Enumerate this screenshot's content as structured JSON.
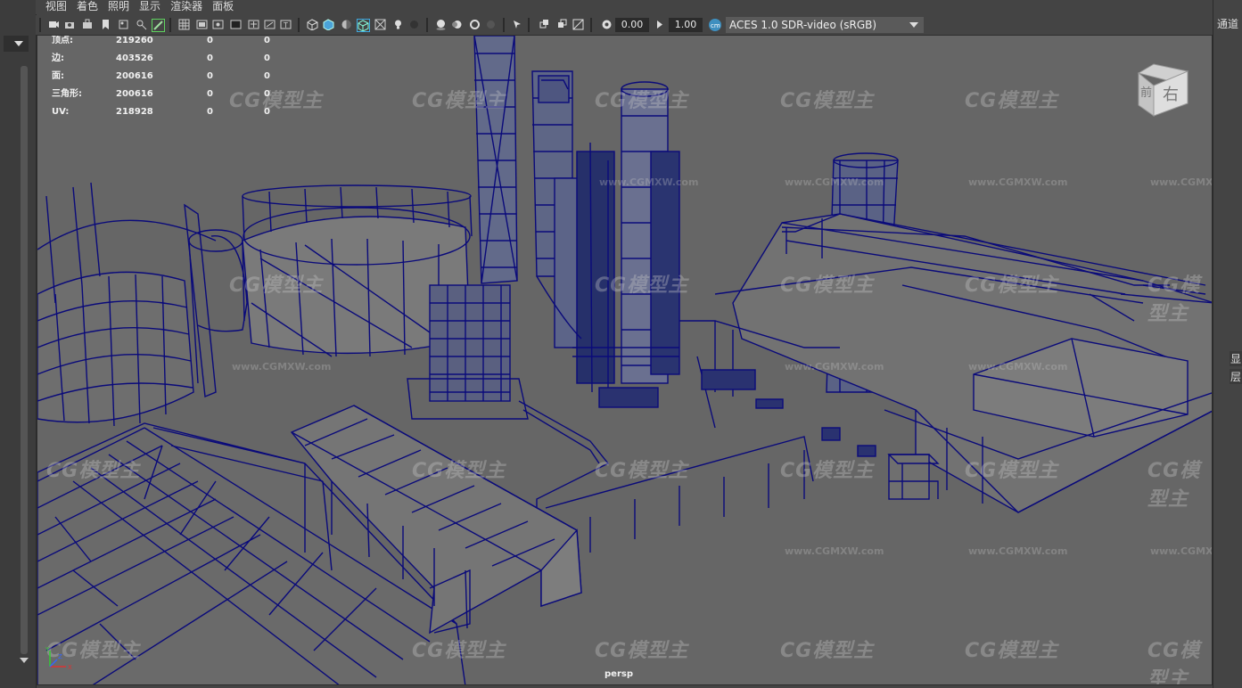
{
  "menu": [
    "视图",
    "着色",
    "照明",
    "显示",
    "渲染器",
    "面板"
  ],
  "toolbar": {
    "exposure": "0.00",
    "gamma": "1.00",
    "color_space": "ACES 1.0 SDR-video (sRGB)"
  },
  "right_panel": {
    "top_text": "通道",
    "side_label_1": "显",
    "side_label_2": "层"
  },
  "hud": {
    "rows": [
      {
        "label": "顶点:",
        "v1": "219260",
        "v2": "0",
        "v3": "0"
      },
      {
        "label": "边:",
        "v1": "403526",
        "v2": "0",
        "v3": "0"
      },
      {
        "label": "面:",
        "v1": "200616",
        "v2": "0",
        "v3": "0"
      },
      {
        "label": "三角形:",
        "v1": "200616",
        "v2": "0",
        "v3": "0"
      },
      {
        "label": "UV:",
        "v1": "218928",
        "v2": "0",
        "v3": "0"
      }
    ]
  },
  "viewport": {
    "camera_label": "persp",
    "viewcube_front": "前",
    "viewcube_right": "右",
    "axis_x": "X",
    "axis_y": "Y",
    "axis_z": "Z"
  },
  "watermark": {
    "logo": "CG模型主",
    "url": "www.CGMXW.com"
  },
  "colors": {
    "wireframe": "#0a0a7a",
    "viewport_bg": "#666666",
    "panel_bg": "#444444"
  }
}
